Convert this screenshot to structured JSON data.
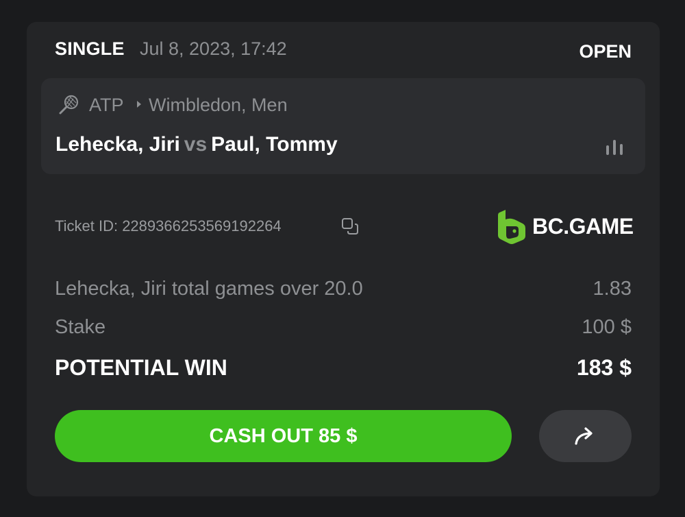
{
  "bet": {
    "type": "SINGLE",
    "date": "Jul 8, 2023, 17:42",
    "status": "OPEN"
  },
  "event": {
    "sport_icon": "tennis-racket-icon",
    "league": "ATP",
    "tournament": "Wimbledon, Men",
    "home": "Lehecka, Jiri",
    "vs": "vs",
    "away": "Paul, Tommy",
    "stats_icon": "bar-chart-icon"
  },
  "ticket": {
    "label": "Ticket ID: 2289366253569192264",
    "copy_icon": "copy-icon"
  },
  "brand": {
    "name": "BC.GAME",
    "color": "#6fc532"
  },
  "selection": {
    "label": "Lehecka, Jiri total games over 20.0",
    "odds": "1.83"
  },
  "stake": {
    "label": "Stake",
    "value": "100 $"
  },
  "potential_win": {
    "label": "POTENTIAL WIN",
    "value": "183 $"
  },
  "actions": {
    "cashout_label": "CASH OUT 85 $",
    "share_icon": "share-arrow-icon"
  },
  "colors": {
    "accent": "#3fbf1f",
    "background": "#1a1b1d",
    "card": "#242527",
    "muted_text": "#8e9093"
  }
}
